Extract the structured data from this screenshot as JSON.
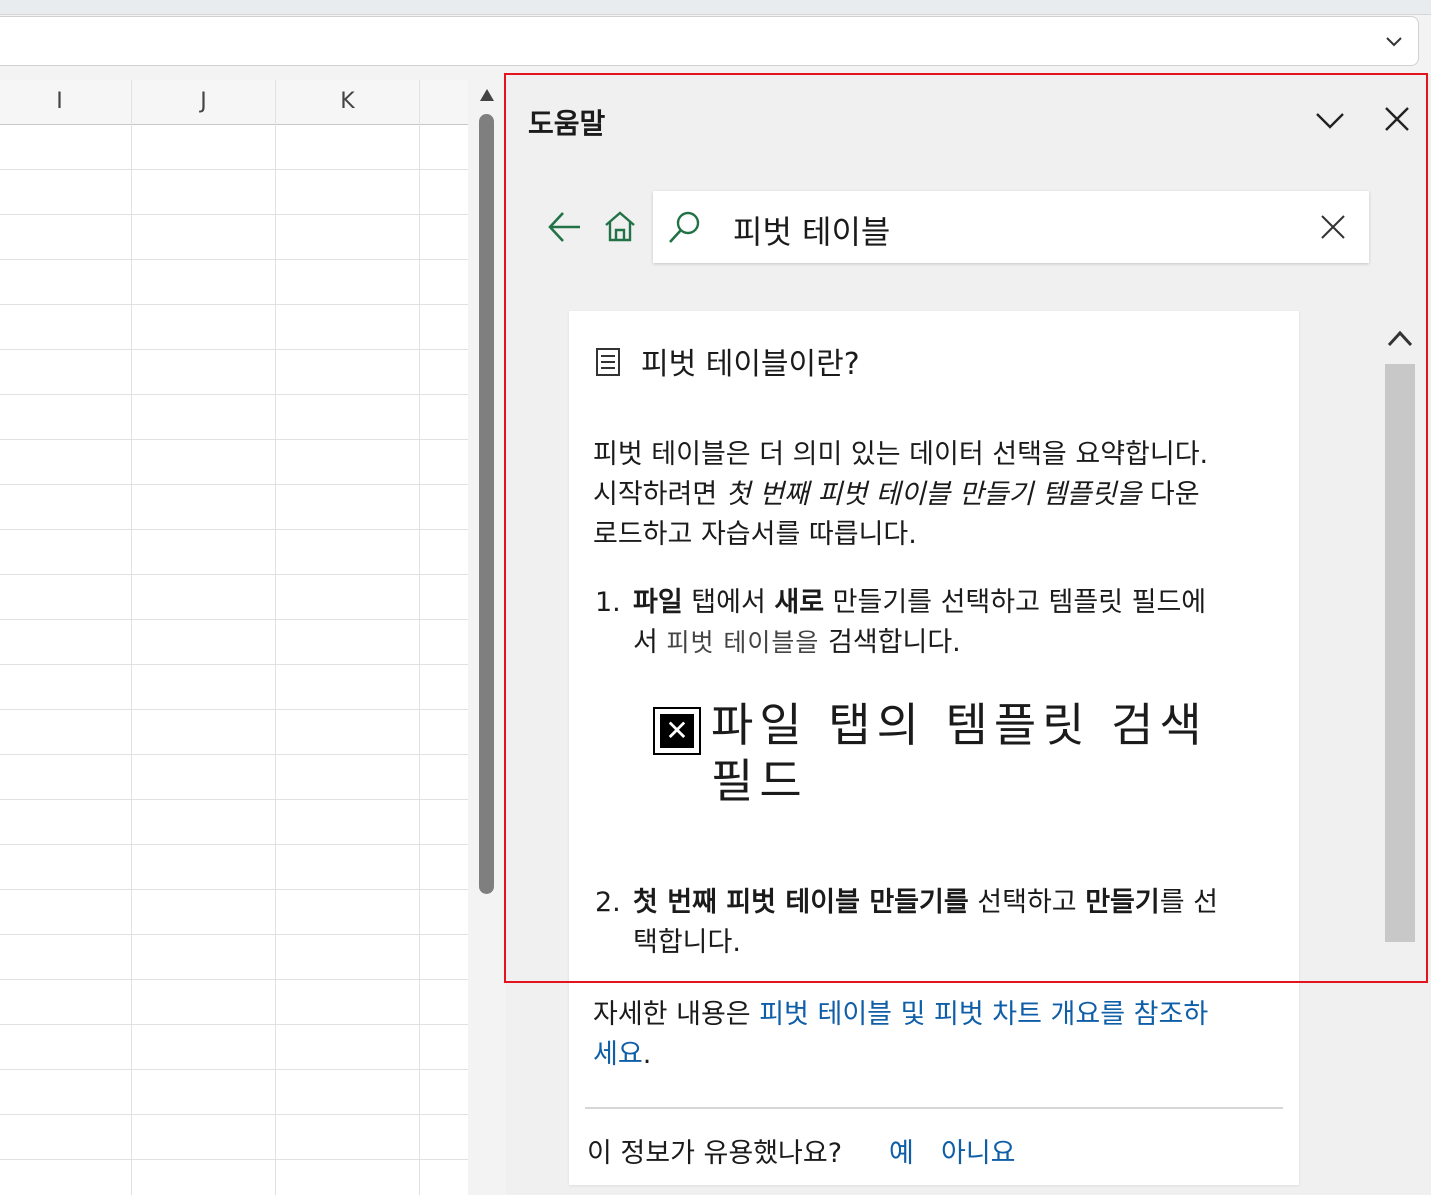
{
  "sheet": {
    "columns": [
      "I",
      "J",
      "K"
    ]
  },
  "help": {
    "title": "도움말",
    "search": {
      "query": "피벗 테이블"
    },
    "article": {
      "title": "피벗 테이블이란?",
      "intro_1": "피벗 테이블은 더 의미 있는 데이터 선택을 요약합니다. 시작하려면 ",
      "intro_italic": "첫 번째 피벗 테이블 만들기 템플릿을",
      "intro_2": " 다운로드하고 자습서를 따릅니다.",
      "steps": [
        {
          "num": "1.",
          "b1": "파일",
          "t1": " 탭에서 ",
          "b2": "새로",
          "t2": " 만들기를 선택하고 템플릿 필드에서 ",
          "ui": "피벗 테이블을",
          "t3": " 검색합니다."
        },
        {
          "num": "2.",
          "b1": "첫 번째 피벗 테이블 만들기를",
          "t1": " 선택하고 ",
          "b2": "만들기",
          "t2": "를 선택합니다."
        }
      ],
      "image_alt": "파일 탭의 템플릿 검색 필드",
      "more_prefix": "자세한 내용은 ",
      "more_link": "피벗 테이블 및 피벗 차트 개요를 참조하세요",
      "more_suffix": "."
    },
    "feedback": {
      "question": "이 정보가 유용했나요?",
      "yes": "예",
      "no": "아니요"
    }
  },
  "colors": {
    "accent_green": "#217346",
    "link": "#0f5ea8",
    "highlight": "#e3141d"
  }
}
